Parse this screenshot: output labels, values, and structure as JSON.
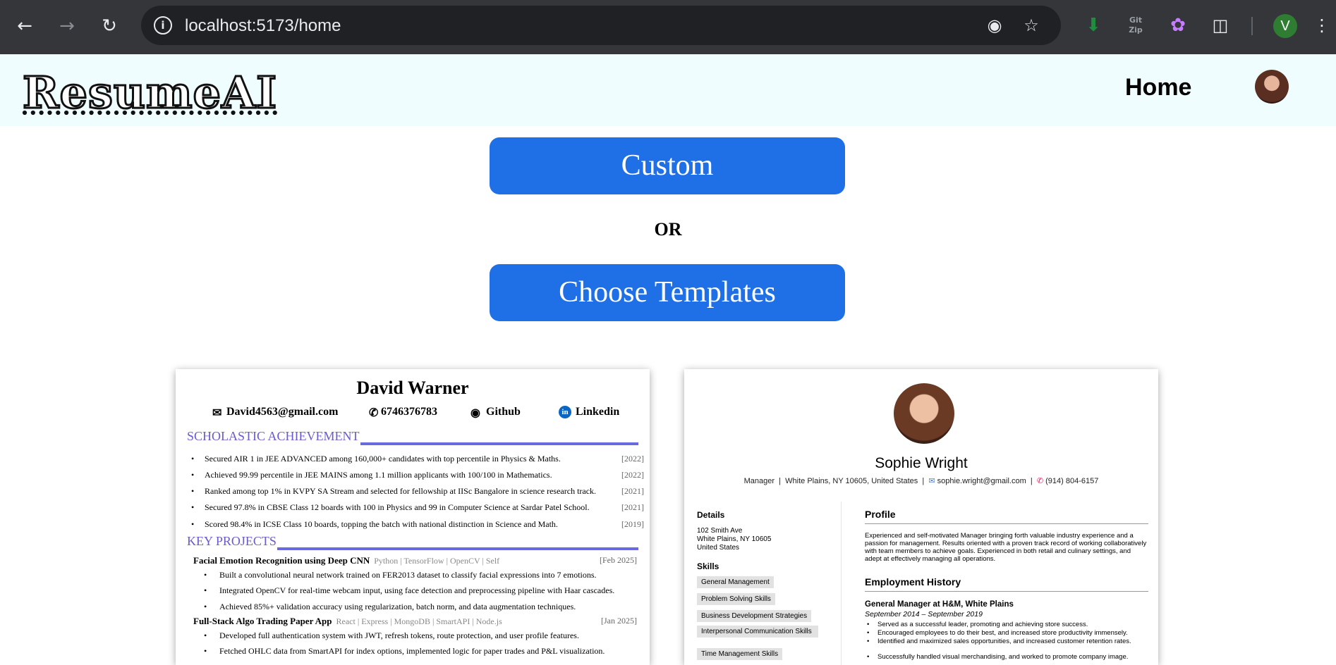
{
  "browser": {
    "url": "localhost:5173/home",
    "icons": [
      "back-icon",
      "forward-icon",
      "reload-icon",
      "info-icon",
      "eye-off-icon",
      "star-icon",
      "download-extension-icon",
      "gitzip-extension-icon",
      "brain-extension-icon",
      "extensions-puzzle-icon",
      "more-vert-icon"
    ],
    "gitzip_label": "Git Zip",
    "profile_initial": "V"
  },
  "header": {
    "logo": "ResumeAI",
    "nav_home": "Home"
  },
  "actions": {
    "custom": "Custom",
    "or": "OR",
    "templates": "Choose Templates"
  },
  "resume1": {
    "name": "David Warner",
    "email": "David4563@gmail.com",
    "phone": "6746376783",
    "github": "Github",
    "linkedin": "Linkedin",
    "sections": {
      "scholastic": "SCHOLASTIC ACHIEVEMENT",
      "projects": "KEY PROJECTS"
    },
    "achievements": [
      {
        "text": "Secured AIR 1 in JEE ADVANCED among 160,000+ candidates with top percentile in Physics & Maths.",
        "year": "[2022]"
      },
      {
        "text": "Achieved 99.99 percentile in JEE MAINS among 1.1 million applicants with 100/100 in Mathematics.",
        "year": "[2022]"
      },
      {
        "text": "Ranked among top 1% in KVPY SA Stream and selected for fellowship at IISc Bangalore in science research track.",
        "year": "[2021]"
      },
      {
        "text": "Secured 97.8% in CBSE Class 12 boards with 100 in Physics and 99 in Computer Science at Sardar Patel School.",
        "year": "[2021]"
      },
      {
        "text": "Scored 98.4% in ICSE Class 10 boards, topping the batch with national distinction in Science and Math.",
        "year": "[2019]"
      }
    ],
    "projects": [
      {
        "title": "Facial Emotion Recognition using Deep CNN",
        "tech": "Python | TensorFlow | OpenCV | Self",
        "date": "[Feb 2025]",
        "bullets": [
          "Built a convolutional neural network trained on FER2013 dataset to classify facial expressions into 7 emotions.",
          "Integrated OpenCV for real-time webcam input, using face detection and preprocessing pipeline with Haar cascades.",
          "Achieved 85%+ validation accuracy using regularization, batch norm, and data augmentation techniques."
        ]
      },
      {
        "title": "Full-Stack Algo Trading Paper App",
        "tech": "React | Express | MongoDB | SmartAPI | Node.js",
        "date": "[Jan 2025]",
        "bullets": [
          "Developed full authentication system with JWT, refresh tokens, route protection, and user profile features.",
          "Fetched OHLC data from SmartAPI for index options, implemented logic for paper trades and P&L visualization."
        ]
      }
    ]
  },
  "resume2": {
    "name": "Sophie Wright",
    "contact_title": "Manager",
    "contact_location": "White Plains, NY 10605, United States",
    "contact_email": "sophie.wright@gmail.com",
    "contact_phone": "(914) 804-6157",
    "details_heading": "Details",
    "address": [
      "102 Smith Ave",
      "White Plains, NY 10605",
      "United States"
    ],
    "skills_heading": "Skills",
    "skills": [
      "General Management",
      "Problem Solving Skills",
      "Business Development Strategies",
      "Interpersonal Communication Skills",
      "Time Management Skills"
    ],
    "profile_heading": "Profile",
    "profile_text": "Experienced and self-motivated Manager bringing forth valuable industry experience and a passion for management. Results oriented with a proven track record of working collaboratively with team members to achieve goals. Experienced in both retail and culinary settings, and adept at effectively managing all operations.",
    "employment_heading": "Employment History",
    "job_title": "General Manager at H&M, White Plains",
    "job_dates": "September 2014 – September 2019",
    "job_bullets": [
      "Served as a successful leader, promoting and achieving store success.",
      "Encouraged employees to do their best, and increased store productivity immensely.",
      "Identified and maximized sales opportunities, and increased customer retention rates.",
      "Successfully handled visual merchandising, and worked to promote company image."
    ]
  },
  "colors": {
    "primary_button": "#1f6fe6",
    "header_bg": "#f0fdfe",
    "section_accent": "#6a5acd"
  }
}
